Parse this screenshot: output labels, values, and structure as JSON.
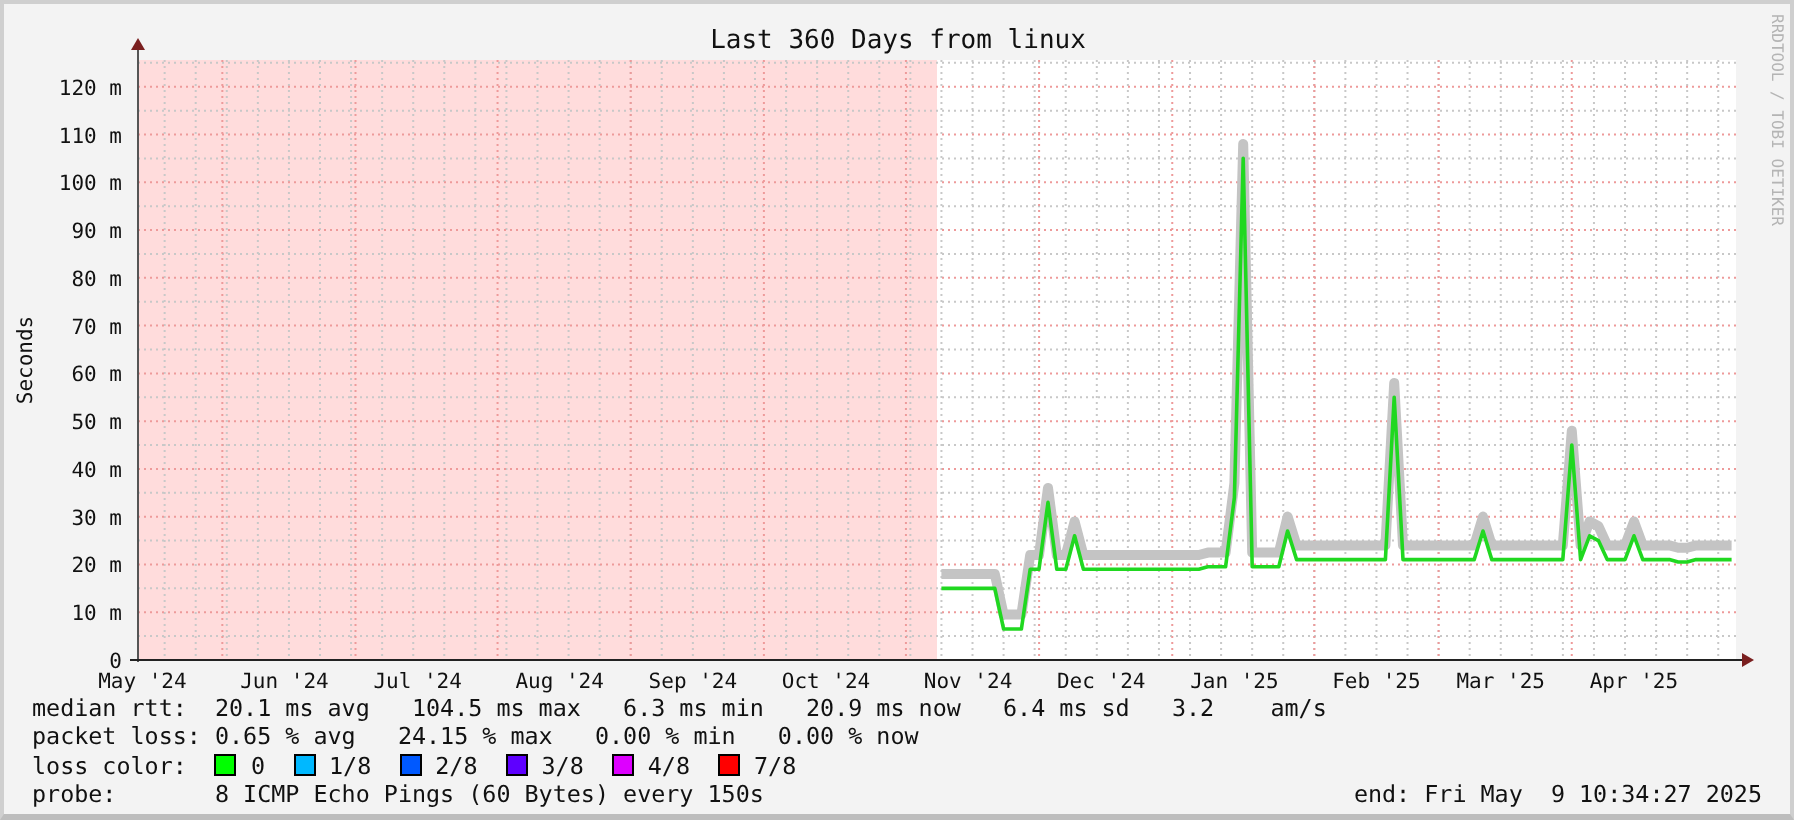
{
  "graph": {
    "title": "Last 360 Days from linux",
    "credit": "RRDTOOL / TOBI OETIKER",
    "chart_data": {
      "type": "line",
      "ylabel": "Seconds",
      "grid": true,
      "ylim": [
        0,
        125.6
      ],
      "yticks": [
        {
          "value": 0,
          "label": "0"
        },
        {
          "value": 10,
          "label": "10 m"
        },
        {
          "value": 20,
          "label": "20 m"
        },
        {
          "value": 30,
          "label": "30 m"
        },
        {
          "value": 40,
          "label": "40 m"
        },
        {
          "value": 50,
          "label": "50 m"
        },
        {
          "value": 60,
          "label": "60 m"
        },
        {
          "value": 70,
          "label": "70 m"
        },
        {
          "value": 80,
          "label": "80 m"
        },
        {
          "value": 90,
          "label": "90 m"
        },
        {
          "value": 100,
          "label": "100 m"
        },
        {
          "value": 110,
          "label": "110 m"
        },
        {
          "value": 120,
          "label": "120 m"
        }
      ],
      "categories": [
        "May '24",
        null,
        null,
        null,
        null,
        null,
        null,
        null,
        null,
        null,
        null,
        null,
        null,
        null,
        null,
        null,
        "Jun '24",
        null,
        null,
        null,
        null,
        null,
        null,
        null,
        null,
        null,
        null,
        null,
        null,
        null,
        null,
        "Jul '24",
        null,
        null,
        null,
        null,
        null,
        null,
        null,
        null,
        null,
        null,
        null,
        null,
        null,
        null,
        null,
        "Aug '24",
        null,
        null,
        null,
        null,
        null,
        null,
        null,
        null,
        null,
        null,
        null,
        null,
        null,
        null,
        "Sep '24",
        null,
        null,
        null,
        null,
        null,
        null,
        null,
        null,
        null,
        null,
        null,
        null,
        null,
        null,
        "Oct '24",
        null,
        null,
        null,
        null,
        null,
        null,
        null,
        null,
        null,
        null,
        null,
        null,
        null,
        null,
        null,
        "Nov '24",
        null,
        null,
        null,
        null,
        null,
        null,
        null,
        null,
        null,
        null,
        null,
        null,
        null,
        null,
        "Dec '24",
        null,
        null,
        null,
        null,
        null,
        null,
        null,
        null,
        null,
        null,
        null,
        null,
        null,
        null,
        "Jan '25",
        null,
        null,
        null,
        null,
        null,
        null,
        null,
        null,
        null,
        null,
        null,
        null,
        null,
        null,
        null,
        "Feb '25",
        null,
        null,
        null,
        null,
        null,
        null,
        null,
        null,
        null,
        null,
        null,
        null,
        null,
        "Mar '25",
        null,
        null,
        null,
        null,
        null,
        null,
        null,
        null,
        null,
        null,
        null,
        null,
        null,
        null,
        "Apr '25",
        null,
        null,
        null,
        null,
        null,
        null,
        null,
        null,
        null,
        null,
        null
      ],
      "series": [
        {
          "color": "#c4c4c4",
          "values": [
            null,
            null,
            null,
            null,
            null,
            null,
            null,
            null,
            null,
            null,
            null,
            null,
            null,
            null,
            null,
            null,
            null,
            null,
            null,
            null,
            null,
            null,
            null,
            null,
            null,
            null,
            null,
            null,
            null,
            null,
            null,
            null,
            null,
            null,
            null,
            null,
            null,
            null,
            null,
            null,
            null,
            null,
            null,
            null,
            null,
            null,
            null,
            null,
            null,
            null,
            null,
            null,
            null,
            null,
            null,
            null,
            null,
            null,
            null,
            null,
            null,
            null,
            null,
            null,
            null,
            null,
            null,
            null,
            null,
            null,
            null,
            null,
            null,
            null,
            null,
            null,
            null,
            null,
            null,
            null,
            null,
            null,
            null,
            null,
            null,
            null,
            null,
            null,
            null,
            null,
            18,
            18,
            18,
            18,
            18,
            18,
            18,
            9.5,
            9.5,
            9.5,
            22,
            22,
            36,
            22,
            22,
            29,
            22,
            22,
            22,
            22,
            22,
            22,
            22,
            22,
            22,
            22,
            22,
            22,
            22,
            22,
            22.5,
            22.5,
            22.5,
            37,
            108,
            22.5,
            22.5,
            22.5,
            22.5,
            30,
            24,
            24,
            24,
            24,
            24,
            24,
            24,
            24,
            24,
            24,
            24,
            58,
            24,
            24,
            24,
            24,
            24,
            24,
            24,
            24,
            24,
            30,
            24,
            24,
            24,
            24,
            24,
            24,
            24,
            24,
            24,
            48,
            24,
            29,
            28,
            24,
            24,
            24,
            29,
            24,
            24,
            24,
            24,
            23.5,
            23.5,
            24,
            24,
            24,
            24,
            24
          ]
        },
        {
          "color": "#20d820",
          "values": [
            null,
            null,
            null,
            null,
            null,
            null,
            null,
            null,
            null,
            null,
            null,
            null,
            null,
            null,
            null,
            null,
            null,
            null,
            null,
            null,
            null,
            null,
            null,
            null,
            null,
            null,
            null,
            null,
            null,
            null,
            null,
            null,
            null,
            null,
            null,
            null,
            null,
            null,
            null,
            null,
            null,
            null,
            null,
            null,
            null,
            null,
            null,
            null,
            null,
            null,
            null,
            null,
            null,
            null,
            null,
            null,
            null,
            null,
            null,
            null,
            null,
            null,
            null,
            null,
            null,
            null,
            null,
            null,
            null,
            null,
            null,
            null,
            null,
            null,
            null,
            null,
            null,
            null,
            null,
            null,
            null,
            null,
            null,
            null,
            null,
            null,
            null,
            null,
            null,
            null,
            15,
            15,
            15,
            15,
            15,
            15,
            15,
            6.5,
            6.5,
            6.5,
            19,
            19,
            33,
            19,
            19,
            26,
            19,
            19,
            19,
            19,
            19,
            19,
            19,
            19,
            19,
            19,
            19,
            19,
            19,
            19,
            19.5,
            19.5,
            19.5,
            34,
            105,
            19.5,
            19.5,
            19.5,
            19.5,
            27,
            21,
            21,
            21,
            21,
            21,
            21,
            21,
            21,
            21,
            21,
            21,
            55,
            21,
            21,
            21,
            21,
            21,
            21,
            21,
            21,
            21,
            27,
            21,
            21,
            21,
            21,
            21,
            21,
            21,
            21,
            21,
            45,
            21,
            26,
            25,
            21,
            21,
            21,
            26,
            21,
            21,
            21,
            21,
            20.5,
            20.5,
            21,
            21,
            21,
            21,
            21
          ]
        }
      ]
    }
  },
  "legend": {
    "rows": [
      {
        "label": "median rtt:",
        "text": "20.1 ms avg   104.5 ms max   6.3 ms min   20.9 ms now   6.4 ms sd   3.2    am/s"
      },
      {
        "label": "packet loss:",
        "text": "0.65 % avg   24.15 % max   0.00 % min   0.00 % now"
      }
    ],
    "loss_label": "loss color:",
    "loss_colors": [
      {
        "label": "0",
        "color": "#00ff00"
      },
      {
        "label": "1/8",
        "color": "#00b8ff"
      },
      {
        "label": "2/8",
        "color": "#0059ff"
      },
      {
        "label": "3/8",
        "color": "#5e00ff"
      },
      {
        "label": "4/8",
        "color": "#dd00ff"
      },
      {
        "label": "7/8",
        "color": "#ff0000"
      }
    ],
    "probe_label": "probe:",
    "probe_text": "8 ICMP Echo Pings (60 Bytes) every 150s",
    "end": "end: Fri May  9 10:34:27 2025"
  }
}
